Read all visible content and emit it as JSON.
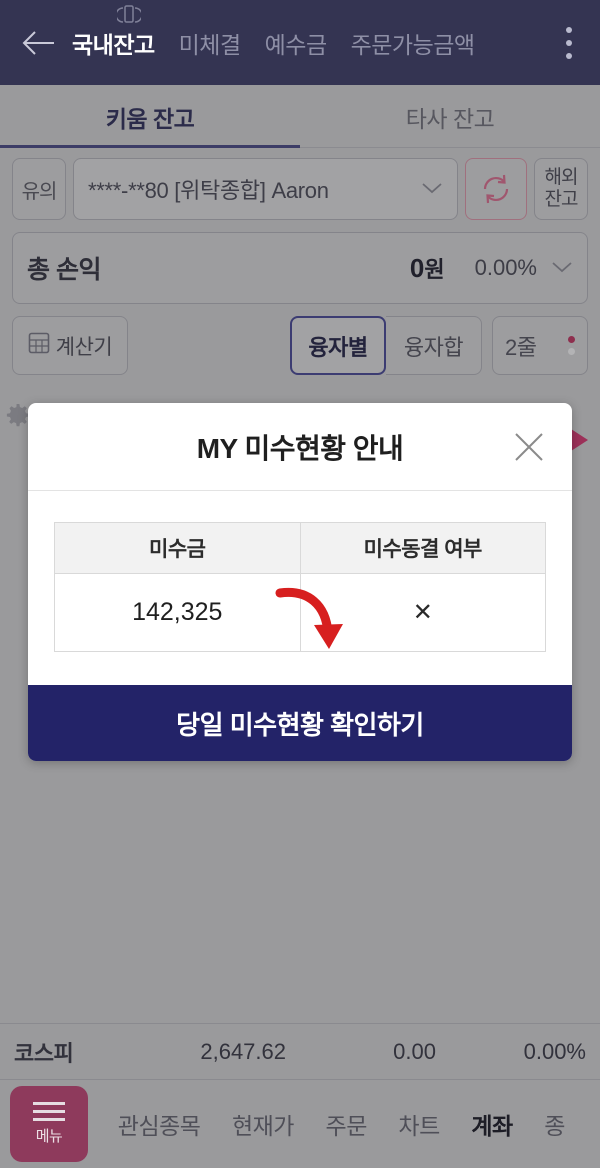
{
  "header": {
    "back_icon": "back-arrow-icon",
    "device_icon": "device-badge-icon",
    "menu_icon": "kebab-menu-icon",
    "tabs": [
      {
        "label": "국내잔고",
        "active": true
      },
      {
        "label": "미체결",
        "active": false
      },
      {
        "label": "예수금",
        "active": false
      },
      {
        "label": "주문가능금액",
        "active": false
      }
    ],
    "background_color": "#343452"
  },
  "subtabs": [
    {
      "label": "키움 잔고",
      "active": true
    },
    {
      "label": "타사 잔고",
      "active": false
    }
  ],
  "account_row": {
    "warn_label": "유의",
    "account_text": "****-**80 [위탁종합] Aaron",
    "caret_icon": "chevron-down-icon",
    "refresh_icon": "refresh-icon",
    "overseas_line1": "해외",
    "overseas_line2": "잔고"
  },
  "pnl": {
    "label": "총 손익",
    "amount": "0",
    "currency": "원",
    "percent": "0.00%",
    "caret_icon": "chevron-down-icon"
  },
  "filters": {
    "calc_label": "계산기",
    "calc_icon": "calculator-icon",
    "segments": [
      {
        "label": "융자별",
        "active": true
      },
      {
        "label": "융자합",
        "active": false
      }
    ],
    "rows_label": "2줄",
    "rows_dot_top_color": "#8e2f4e",
    "rows_dot_bottom_color": "#b3b3b5"
  },
  "side_widgets": {
    "gear_icon": "gear-icon",
    "play_icon": "play-triangle-icon",
    "play_color": "#9c3159"
  },
  "modal": {
    "title": "MY 미수현황 안내",
    "close_icon": "close-icon",
    "table": {
      "columns": [
        "미수금",
        "미수동결 여부"
      ],
      "rows": [
        [
          "142,325",
          "✕"
        ]
      ]
    },
    "annotation_icon": "red-curved-arrow-icon",
    "annotation_color": "#d71f1f",
    "cta_label": "당일 미수현황 확인하기",
    "cta_color": "#232368"
  },
  "ticker": {
    "name": "코스피",
    "value": "2,647.62",
    "change": "0.00",
    "change_percent": "0.00%"
  },
  "bottom_nav": {
    "menu_label": "메뉴",
    "menu_icon": "hamburger-icon",
    "menu_color": "#8e3a5c",
    "items": [
      {
        "label": "관심종목",
        "active": false
      },
      {
        "label": "현재가",
        "active": false
      },
      {
        "label": "주문",
        "active": false
      },
      {
        "label": "차트",
        "active": false
      },
      {
        "label": "계좌",
        "active": true
      },
      {
        "label": "종",
        "active": false
      }
    ]
  }
}
